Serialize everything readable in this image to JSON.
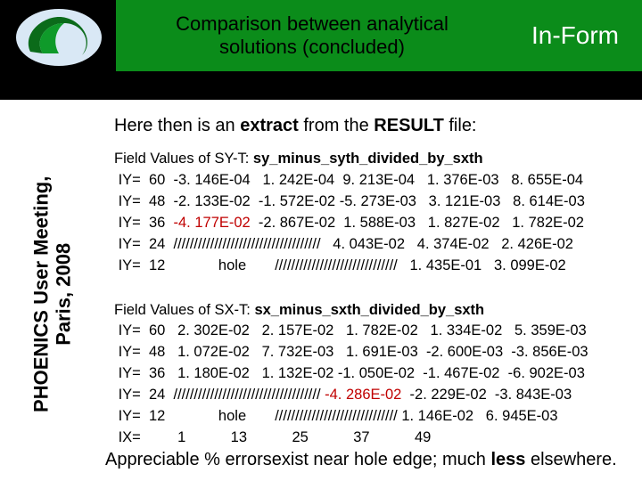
{
  "header": {
    "title_l1": "Comparison between analytical",
    "title_l2": "solutions (concluded)",
    "brand": "In-Form"
  },
  "sidebar": {
    "line1": "PHOENICS User Meeting,",
    "line2": "Paris, 2008"
  },
  "intro": {
    "pre": "Here then is an ",
    "bold1": "extract",
    "mid": " from the ",
    "bold2": "RESULT",
    "post": " file:"
  },
  "sy": {
    "head_pre": "Field Values of SY-T: ",
    "head_bold": "sy_minus_syth_divided_by_sxth",
    "rows": [
      " IY=  60  -3. 146E-04   1. 242E-04  9. 213E-04   1. 376E-03   8. 655E-04",
      " IY=  48  -2. 133E-02  -1. 572E-02 -5. 273E-03   3. 121E-03   8. 614E-03"
    ],
    "row36_pre": " IY=  36  ",
    "row36_red": "-4. 177E-02",
    "row36_post": "  -2. 867E-02  1. 588E-03   1. 827E-02   1. 782E-02",
    "rows_after": [
      " IY=  24  ////////////////////////////////////   4. 043E-02   4. 374E-02   2. 426E-02",
      " IY=  12             hole       //////////////////////////////   1. 435E-01   3. 099E-02"
    ]
  },
  "sx": {
    "head_pre": "Field Values of SX-T: ",
    "head_bold": "sx_minus_sxth_divided_by_sxth",
    "rows": [
      " IY=  60   2. 302E-02   2. 157E-02   1. 782E-02   1. 334E-02   5. 359E-03",
      " IY=  48   1. 072E-02   7. 732E-03   1. 691E-03  -2. 600E-03  -3. 856E-03",
      " IY=  36   1. 180E-02   1. 132E-02 -1. 050E-02  -1. 467E-02  -6. 902E-03"
    ],
    "row24_pre": " IY=  24  //////////////////////////////////// ",
    "row24_red": "-4. 286E-02",
    "row24_post": "  -2. 229E-02  -3. 843E-03",
    "rows_after": [
      " IY=  12             hole       ////////////////////////////// 1. 146E-02   6. 945E-03",
      " IX=         1           13           25           37           49"
    ]
  },
  "footer": {
    "t1": "Appreciable % errors",
    "t2": "exist near hole edge; much ",
    "bold": "less",
    "t3": " elsewhere."
  }
}
